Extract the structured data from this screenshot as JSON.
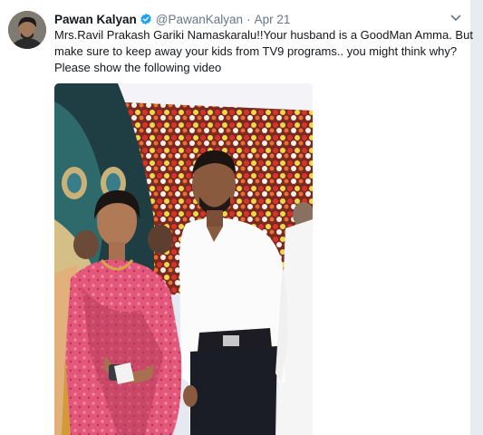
{
  "tweet": {
    "author_name": "Pawan Kalyan",
    "handle": "@PawanKalyan",
    "separator": "·",
    "date": "Apr 21",
    "verified": true,
    "text_lines": [
      "Mrs.Ravil Prakash Gariki Namaskaralu!!Your husband is a GoodMan Amma. But",
      "make sure to keep away your kids from TV9 programs.. you might think why?",
      "Please show the following video"
    ]
  },
  "colors": {
    "accent": "#1da1f2",
    "muted_text": "#657786",
    "gutter": "#e6ecf0"
  },
  "icons": {
    "verified": "verified-badge-icon",
    "caret": "chevron-down-icon"
  }
}
